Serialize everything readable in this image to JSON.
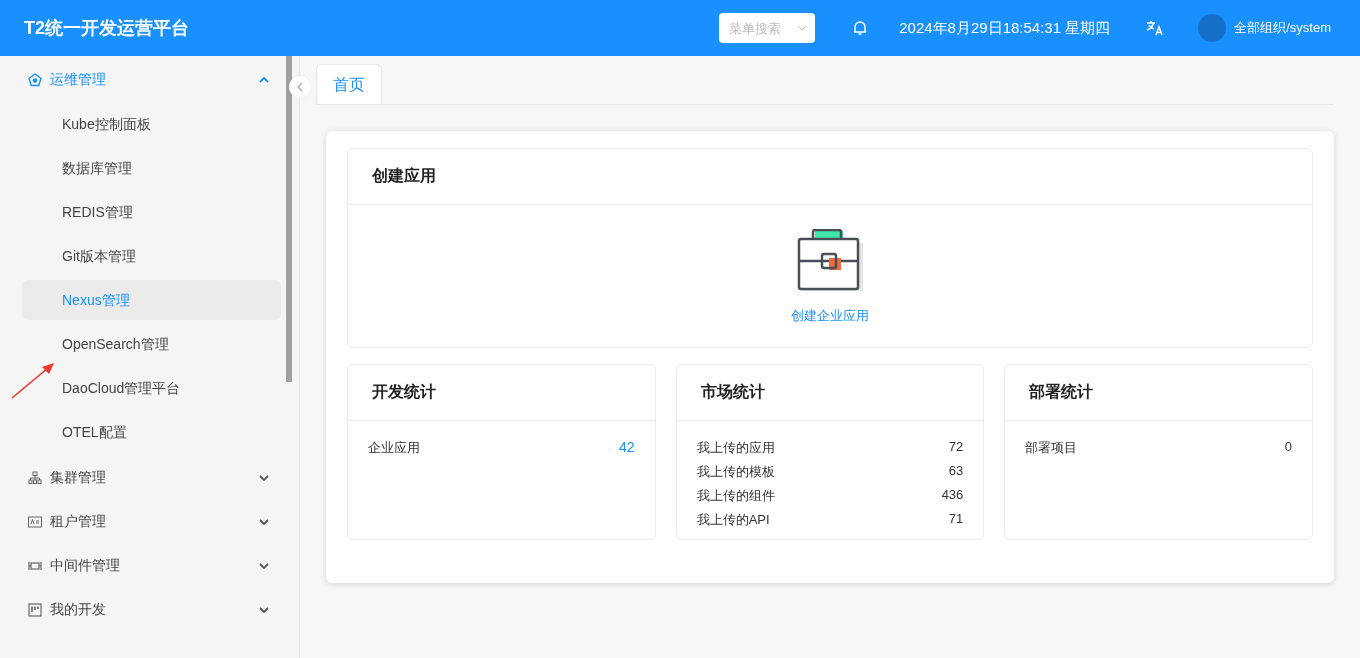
{
  "header": {
    "title": "T2统一开发运营平台",
    "menu_search": {
      "placeholder": "菜单搜索"
    },
    "datetime": "2024年8月29日18:54:31 星期四",
    "user": "全部组织/system"
  },
  "sidebar": {
    "groups": [
      {
        "label": "运维管理",
        "expanded": true,
        "children": [
          {
            "label": "Kube控制面板",
            "selected": false
          },
          {
            "label": "数据库管理",
            "selected": false
          },
          {
            "label": "REDIS管理",
            "selected": false
          },
          {
            "label": "Git版本管理",
            "selected": false
          },
          {
            "label": "Nexus管理",
            "selected": true
          },
          {
            "label": "OpenSearch管理",
            "selected": false
          },
          {
            "label": "DaoCloud管理平台",
            "selected": false
          },
          {
            "label": "OTEL配置",
            "selected": false
          }
        ]
      },
      {
        "label": "集群管理",
        "expanded": false
      },
      {
        "label": "租户管理",
        "expanded": false
      },
      {
        "label": "中间件管理",
        "expanded": false
      },
      {
        "label": "我的开发",
        "expanded": false
      }
    ]
  },
  "tabs": [
    {
      "label": "首页",
      "selected": true
    }
  ],
  "create_app": {
    "title": "创建应用",
    "action": "创建企业应用"
  },
  "stats": [
    {
      "title": "开发统计",
      "rows": [
        {
          "label": "企业应用",
          "value": "42",
          "link": true
        }
      ]
    },
    {
      "title": "市场统计",
      "rows": [
        {
          "label": "我上传的应用",
          "value": "72",
          "link": false
        },
        {
          "label": "我上传的模板",
          "value": "63",
          "link": false
        },
        {
          "label": "我上传的组件",
          "value": "436",
          "link": false
        },
        {
          "label": "我上传的API",
          "value": "71",
          "link": false
        }
      ]
    },
    {
      "title": "部署统计",
      "rows": [
        {
          "label": "部署项目",
          "value": "0",
          "link": false
        }
      ]
    }
  ]
}
